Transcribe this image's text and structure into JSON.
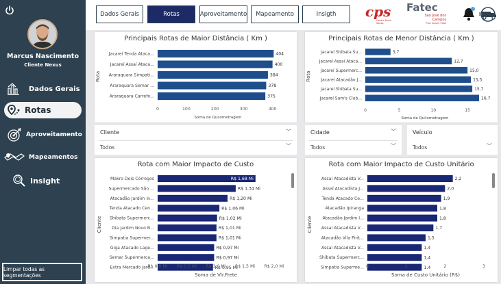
{
  "sidebar": {
    "user_name": "Marcus Nascimento",
    "user_role": "Cliente Nexus",
    "nav": [
      {
        "label": "Dados Gerais",
        "icon": "building-chart-icon"
      },
      {
        "label": "Rotas",
        "icon": "route-pin-icon",
        "active": true
      },
      {
        "label": "Aproveitamento",
        "icon": "target-icon"
      },
      {
        "label": "Mapeamentos",
        "icon": "map-route-icon"
      },
      {
        "label": "Insight",
        "icon": "magnifier-icon"
      }
    ],
    "clear_button": "Limpar todas as segmentações"
  },
  "tabs": [
    "Dados Gerais",
    "Rotas",
    "Aproveitamento",
    "Mapeamento",
    "Insigth"
  ],
  "active_tab": "Rotas",
  "logos": {
    "cps": "cps",
    "cps_sub": "Centro Paula Souza",
    "fatec": "Fatec",
    "fatec_sub1": "São José dos",
    "fatec_sub2": "Campos",
    "fatec_sub3": "Prof. Jessen Vidal"
  },
  "slicers": {
    "cliente": {
      "label": "Cliente",
      "value": "Todos"
    },
    "cidade": {
      "label": "Cidade",
      "value": "Todos"
    },
    "veiculo": {
      "label": "Veículo",
      "value": "Todos"
    }
  },
  "colors": {
    "sidebar": "#2d4150",
    "bar": "#1e4e8c",
    "bar_dark": "#1a2775",
    "active_tab": "#1c2a66"
  },
  "chart_data": [
    {
      "type": "bar",
      "orientation": "horizontal",
      "title": "Principais Rotas de Maior Distância ( Km )",
      "ylabel": "Rota",
      "xlabel": "Soma de Quilometragem",
      "categories": [
        "Jacareí Tenda Ataca...",
        "Jacareí Assaí Ataca...",
        "Araraquara Simpati...",
        "Araraquara Semar ...",
        "Araraquara Carrefo..."
      ],
      "values": [
        404,
        400,
        384,
        378,
        375
      ],
      "value_labels": [
        "404",
        "400",
        "384",
        "378",
        "375"
      ],
      "xticks": [
        "0",
        "100",
        "200",
        "300",
        "400"
      ],
      "xlim": [
        0,
        420
      ]
    },
    {
      "type": "bar",
      "orientation": "horizontal",
      "title": "Principais Rotas de Menor Distância ( Km )",
      "ylabel": "Rota",
      "xlabel": "Soma de Quilometragem",
      "categories": [
        "Jacareí Shibata Su...",
        "Jacareí Assaí Ataca...",
        "Jacareí Supermerc...",
        "Jacareí Atacadão J...",
        "Jacareí Shibata Su...",
        "Jacareí Sam's Club..."
      ],
      "values": [
        3.7,
        12.7,
        15.0,
        15.5,
        15.7,
        16.7
      ],
      "value_labels": [
        "3,7",
        "12,7",
        "15,0",
        "15,5",
        "15,7",
        "16,7"
      ],
      "xticks": [
        "0",
        "5",
        "10",
        "15"
      ],
      "xlim": [
        0,
        17.5
      ]
    },
    {
      "type": "bar",
      "orientation": "horizontal",
      "title": "Rota com Maior Impacto de Custo",
      "ylabel": "Cliente",
      "xlabel": "Soma de Vlr.Frete",
      "categories": [
        "Makro Dois Córregos",
        "Supermercado São ...",
        "Atacadão Jardim In...",
        "Tenda Atacado Cen...",
        "Shibata Supermerc...",
        "Dia Jardim Novo B...",
        "Simpatia Supermer...",
        "Giga Atacado Lage...",
        "Semar Supermerca...",
        "Extra Mercado Jard..."
      ],
      "values": [
        1.68,
        1.34,
        1.2,
        1.06,
        1.02,
        1.01,
        1.01,
        0.97,
        0.97,
        0.95
      ],
      "value_labels": [
        "R$ 1,68 Mi",
        "R$ 1,34 Mi",
        "R$ 1,20 Mi",
        "R$ 1,06 Mi",
        "R$ 1,02 Mi",
        "R$ 1,01 Mi",
        "R$ 1,01 Mi",
        "R$ 0,97 Mi",
        "R$ 0,97 Mi",
        "R$ 0,95 Mi"
      ],
      "xticks": [
        "R$ 0,0 Mi",
        "R$ 0,5 Mi",
        "R$ 1,0 Mi",
        "R$ 1,5 Mi",
        "R$ 2,0 Mi"
      ],
      "xlim": [
        0,
        2.0
      ]
    },
    {
      "type": "bar",
      "orientation": "horizontal",
      "title": "Rota com Maior Impacto de Custo Unitário",
      "ylabel": "Cliente",
      "xlabel": "Soma de Custo Unitário (R$)",
      "categories": [
        "Assaí Atacadista V...",
        "Assaí Atacadista J...",
        "Tenda Atacado Ce...",
        "Atacadão Ipiranga",
        "Atacadão Jardim I...",
        "Assaí Atacadista V...",
        "Atacadão Vila Pirit...",
        "Assaí Atacadista V...",
        "Shibata Supermerc...",
        "Simpatia Superme..."
      ],
      "values": [
        2.2,
        2.0,
        1.9,
        1.8,
        1.8,
        1.7,
        1.5,
        1.4,
        1.4,
        1.4
      ],
      "value_labels": [
        "2,2",
        "2,0",
        "1,9",
        "1,8",
        "1,8",
        "1,7",
        "1,5",
        "1,4",
        "1,4",
        "1,4"
      ],
      "xticks": [
        "0",
        "1",
        "2",
        "3"
      ],
      "xlim": [
        0,
        3
      ]
    }
  ]
}
